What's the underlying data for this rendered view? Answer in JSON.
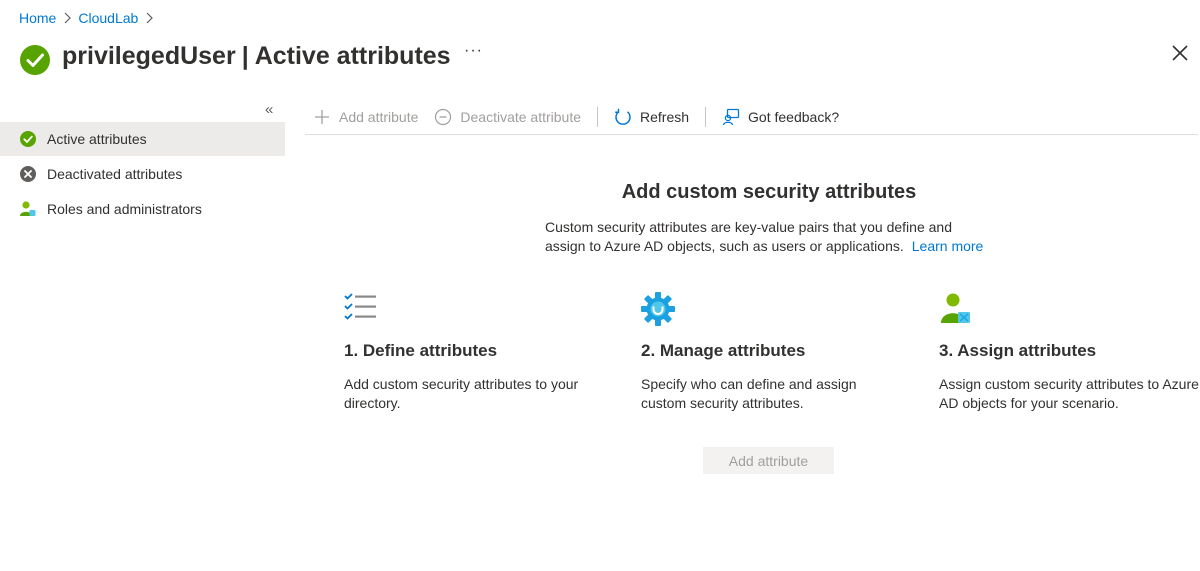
{
  "breadcrumb": {
    "home": "Home",
    "cloudlab": "CloudLab"
  },
  "header": {
    "user": "privilegedUser",
    "separator": "|",
    "page": "Active attributes",
    "more": "···"
  },
  "sidebar": {
    "collapse": "«",
    "items": [
      {
        "label": "Active attributes",
        "icon": "check-circle-icon",
        "active": true
      },
      {
        "label": "Deactivated attributes",
        "icon": "x-circle-icon",
        "active": false
      },
      {
        "label": "Roles and administrators",
        "icon": "user-admin-icon",
        "active": false
      }
    ]
  },
  "toolbar": {
    "add": "Add attribute",
    "deactivate": "Deactivate attribute",
    "refresh": "Refresh",
    "feedback": "Got feedback?"
  },
  "hero": {
    "title": "Add custom security attributes",
    "description": "Custom security attributes are key-value pairs that you define and assign to Azure AD objects, such as users or applications.",
    "learn_more": "Learn more"
  },
  "steps": [
    {
      "title": "1. Define attributes",
      "text": "Add custom security attributes to your directory.",
      "icon": "checklist-icon"
    },
    {
      "title": "2. Manage attributes",
      "text": "Specify who can define and assign custom security attributes.",
      "icon": "gear-icon"
    },
    {
      "title": "3. Assign attributes",
      "text": "Assign custom security attributes to Azure AD objects for your scenario.",
      "icon": "user-assign-icon"
    }
  ],
  "add_button": "Add attribute",
  "colors": {
    "accent": "#0078d4",
    "success": "#57a300",
    "disabled": "#a19f9d",
    "active_bg": "#edebe9"
  }
}
